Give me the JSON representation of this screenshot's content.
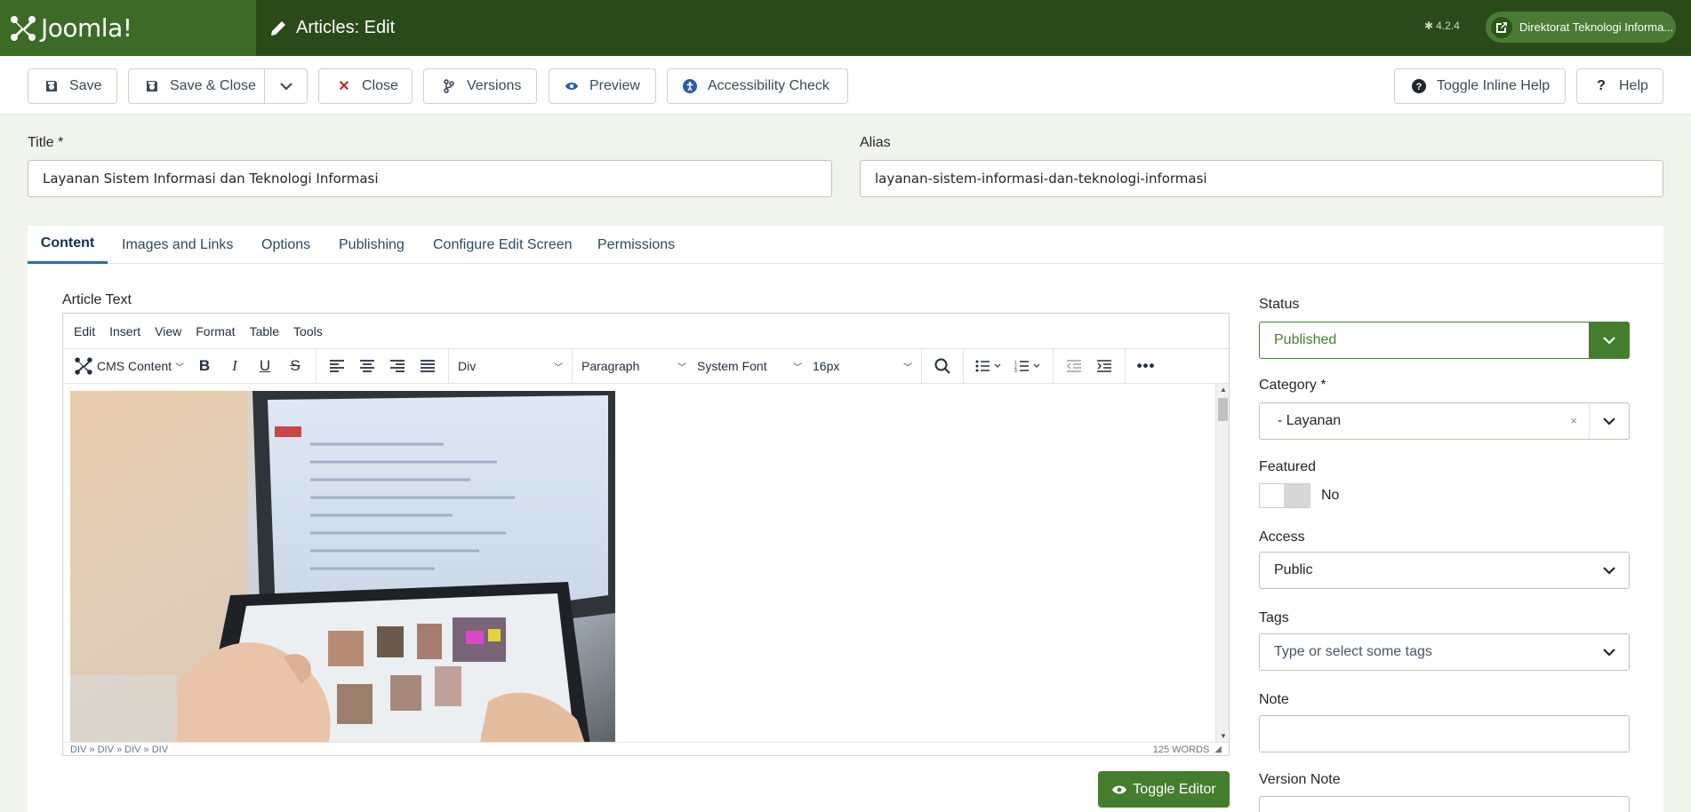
{
  "header": {
    "logo_text": "Joomla!",
    "page_title": "Articles: Edit",
    "version": "4.2.4",
    "site_name": "Direktorat Teknologi Informa..."
  },
  "toolbar": {
    "save": "Save",
    "save_close": "Save & Close",
    "close": "Close",
    "versions": "Versions",
    "preview": "Preview",
    "accessibility": "Accessibility Check",
    "inline_help": "Toggle Inline Help",
    "help": "Help"
  },
  "form": {
    "title_label": "Title *",
    "title_value": "Layanan Sistem Informasi dan Teknologi Informasi",
    "alias_label": "Alias",
    "alias_value": "layanan-sistem-informasi-dan-teknologi-informasi"
  },
  "tabs": [
    "Content",
    "Images and Links",
    "Options",
    "Publishing",
    "Configure Edit Screen",
    "Permissions"
  ],
  "editor": {
    "label": "Article Text",
    "menu": [
      "Edit",
      "Insert",
      "View",
      "Format",
      "Table",
      "Tools"
    ],
    "cms_content": "CMS Content",
    "block_select": "Div",
    "format_select": "Paragraph",
    "font_select": "System Font",
    "size_select": "16px",
    "path": "DIV » DIV » DIV » DIV",
    "word_count": "125 WORDS",
    "toggle_editor": "Toggle Editor"
  },
  "sidebar": {
    "status_label": "Status",
    "status_value": "Published",
    "category_label": "Category *",
    "category_value": "- Layanan",
    "featured_label": "Featured",
    "featured_value": "No",
    "access_label": "Access",
    "access_value": "Public",
    "tags_label": "Tags",
    "tags_placeholder": "Type or select some tags",
    "note_label": "Note",
    "note_value": "",
    "version_note_label": "Version Note"
  },
  "colors": {
    "header_bg": "#2a4a1a",
    "logo_bg": "#3c6a27",
    "accent": "#457d2f",
    "tab_active": "#2a69b8"
  }
}
